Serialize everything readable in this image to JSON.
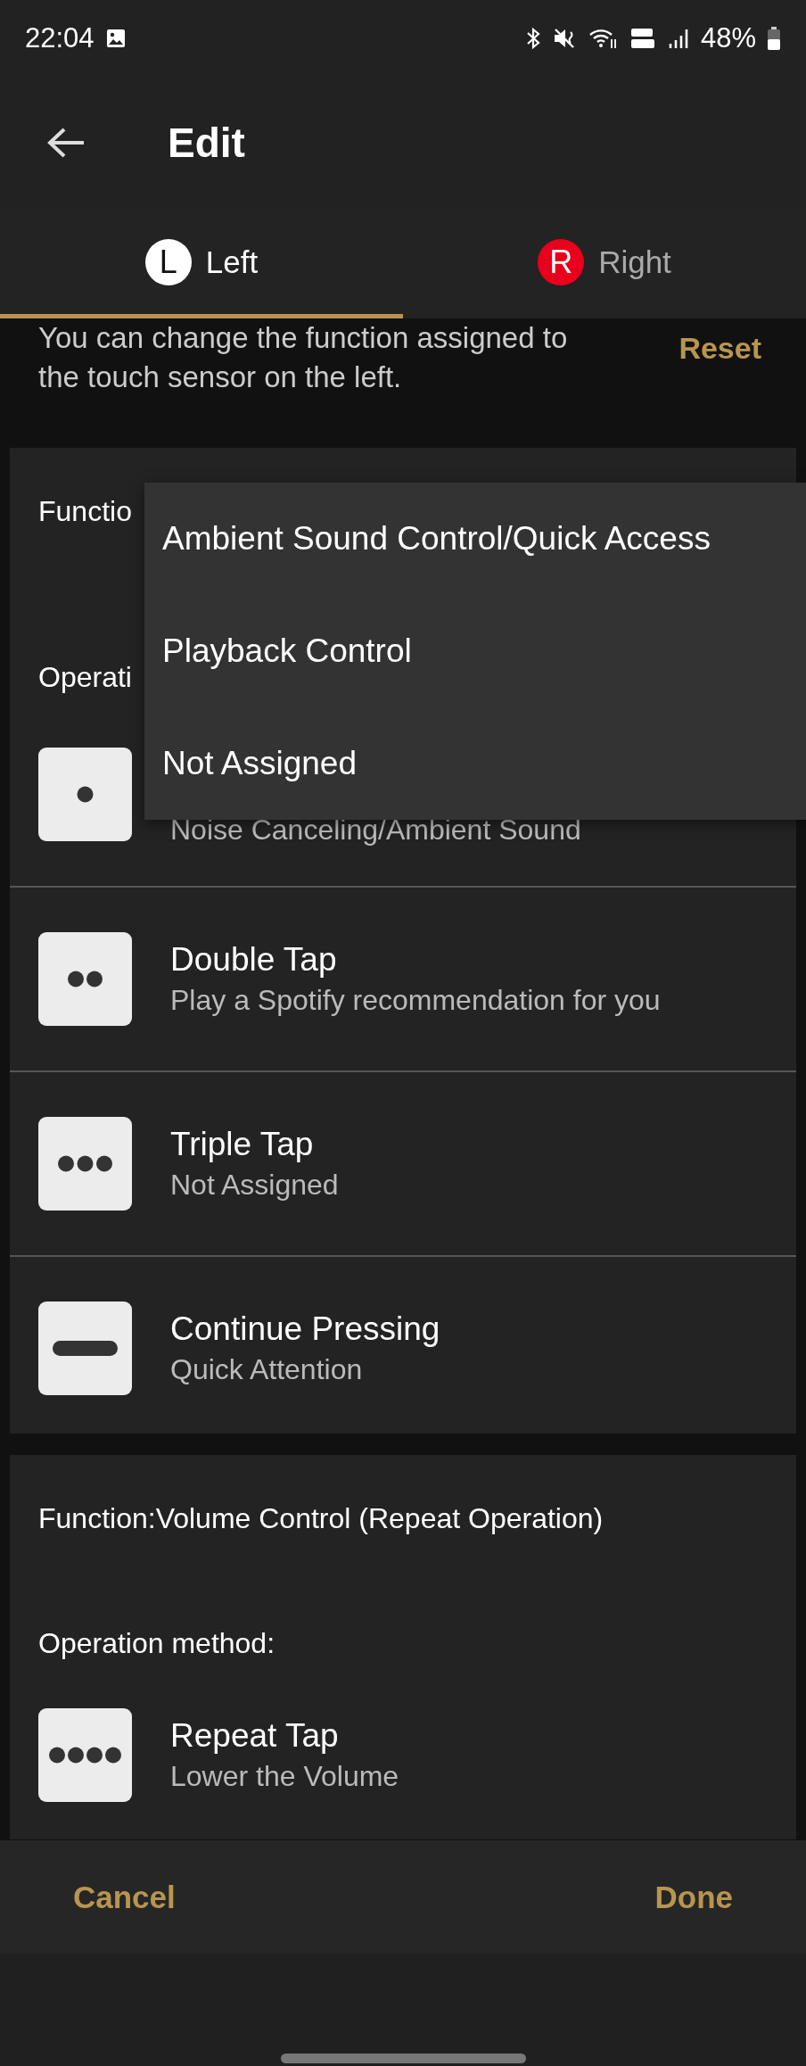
{
  "status_bar": {
    "time": "22:04",
    "battery": "48%"
  },
  "header": {
    "title": "Edit"
  },
  "tabs": [
    {
      "label": "Left",
      "badge": "L",
      "color": "#ffffff",
      "selected": true
    },
    {
      "label": "Right",
      "badge": "R",
      "color": "#e8001c",
      "selected": false
    }
  ],
  "description": "You can change the function assigned to the touch sensor on the left.",
  "reset_button": "Reset",
  "cards": [
    {
      "function_label": "Functio",
      "operation_label": "Operati",
      "rows": [
        {
          "kind": "single-tap",
          "subtitle": "Noise Canceling/Ambient Sound"
        },
        {
          "kind": "double-tap",
          "title": "Double Tap",
          "subtitle": "Play a Spotify recommendation for you"
        },
        {
          "kind": "triple-tap",
          "title": "Triple Tap",
          "subtitle": "Not Assigned"
        },
        {
          "kind": "long-press",
          "title": "Continue Pressing",
          "subtitle": "Quick Attention"
        }
      ]
    },
    {
      "function_label": "Function:Volume Control (Repeat Operation)",
      "operation_label": "Operation method:",
      "rows": [
        {
          "kind": "repeat-tap",
          "title": "Repeat Tap",
          "subtitle": "Lower the Volume"
        }
      ]
    }
  ],
  "dropdown": {
    "items": [
      "Ambient Sound Control/Quick Access",
      "Playback Control",
      "Not Assigned"
    ]
  },
  "footer": {
    "cancel": "Cancel",
    "done": "Done"
  }
}
